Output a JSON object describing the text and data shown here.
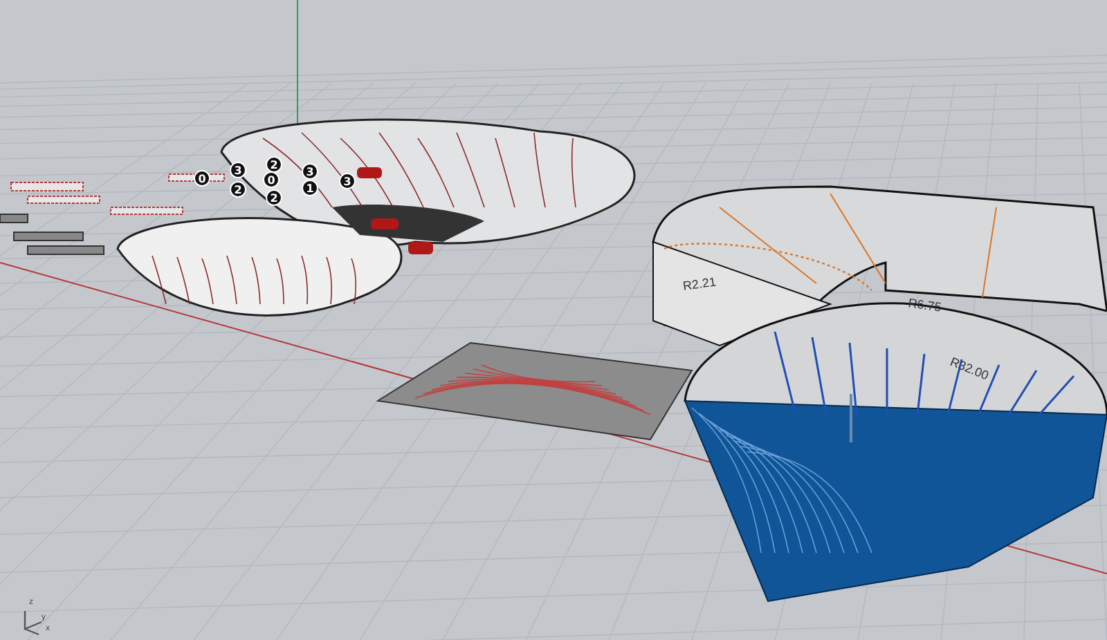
{
  "viewport": {
    "point_markers": [
      "0",
      "3",
      "2",
      "2",
      "0",
      "2",
      "3",
      "1",
      "3"
    ],
    "dimension_labels": [
      "R2.21",
      "R6.75",
      "R32.00"
    ],
    "axis_labels": [
      "z",
      "y",
      "x"
    ]
  }
}
